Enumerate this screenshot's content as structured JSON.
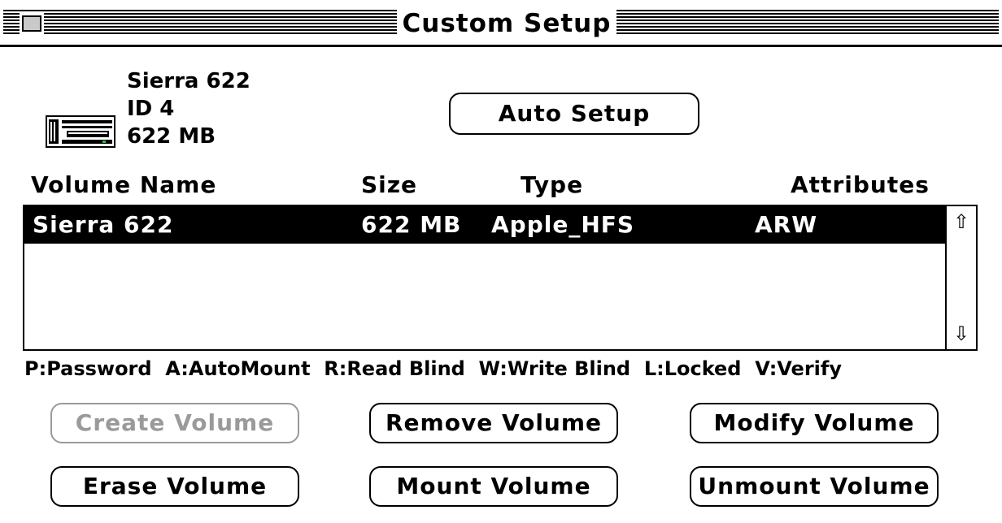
{
  "window": {
    "title": "Custom Setup"
  },
  "drive": {
    "name": "Sierra 622",
    "id": "ID 4",
    "capacity": "622 MB",
    "icon": "hard-drive-icon"
  },
  "buttons": {
    "auto_setup": "Auto Setup",
    "create_volume": "Create Volume",
    "remove_volume": "Remove Volume",
    "modify_volume": "Modify Volume",
    "erase_volume": "Erase Volume",
    "mount_volume": "Mount Volume",
    "unmount_volume": "Unmount Volume"
  },
  "table": {
    "columns": [
      "Volume Name",
      "Size",
      "Type",
      "Attributes"
    ],
    "rows": [
      {
        "name": "Sierra 622",
        "size": "622 MB",
        "type": "Apple_HFS",
        "attributes": "ARW",
        "selected": true
      }
    ]
  },
  "legend": "P:Password  A:AutoMount  R:Read Blind  W:Write Blind  L:Locked  V:Verify",
  "icons": {
    "close": "close-box-icon",
    "scroll_up": "scroll-up-arrow-icon",
    "scroll_down": "scroll-down-arrow-icon"
  },
  "colors": {
    "selection_bg": "#000000",
    "selection_fg": "#ffffff",
    "disabled": "#9a9a9a"
  }
}
